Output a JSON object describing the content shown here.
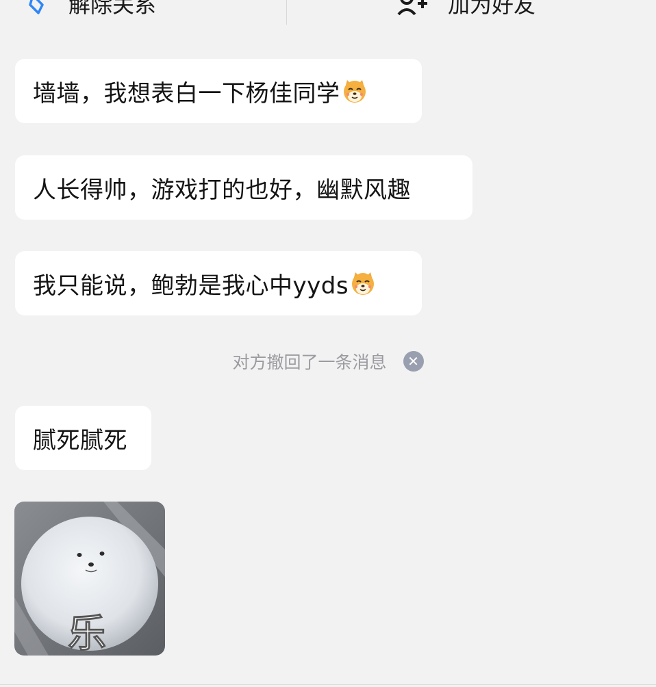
{
  "top_bar": {
    "unbind_label": "解除关系",
    "unbind_icon": "link-break-icon",
    "add_friend_label": "加为好友",
    "add_friend_icon": "add-user-icon"
  },
  "messages": [
    {
      "text": "墙墙，我想表白一下杨佳同学",
      "emoji": "shiba-dog-emoji"
    },
    {
      "text": "人长得帅，游戏打的也好，幽默风趣",
      "emoji": ""
    },
    {
      "text": "我只能说，鲍勃是我心中yyds",
      "emoji": "shiba-dog-emoji"
    },
    {
      "text": "腻死腻死",
      "emoji": ""
    }
  ],
  "system_notice": {
    "text": "对方撤回了一条消息",
    "close_icon": "close-circle-icon"
  },
  "sticker": {
    "caption": "乐",
    "subject": "white-fluffy-dog-sticker"
  },
  "colors": {
    "background": "#f2f2f3",
    "bubble": "#ffffff",
    "notice_text": "#9b9ba0",
    "close_icon_bg": "#9a9fb0"
  }
}
